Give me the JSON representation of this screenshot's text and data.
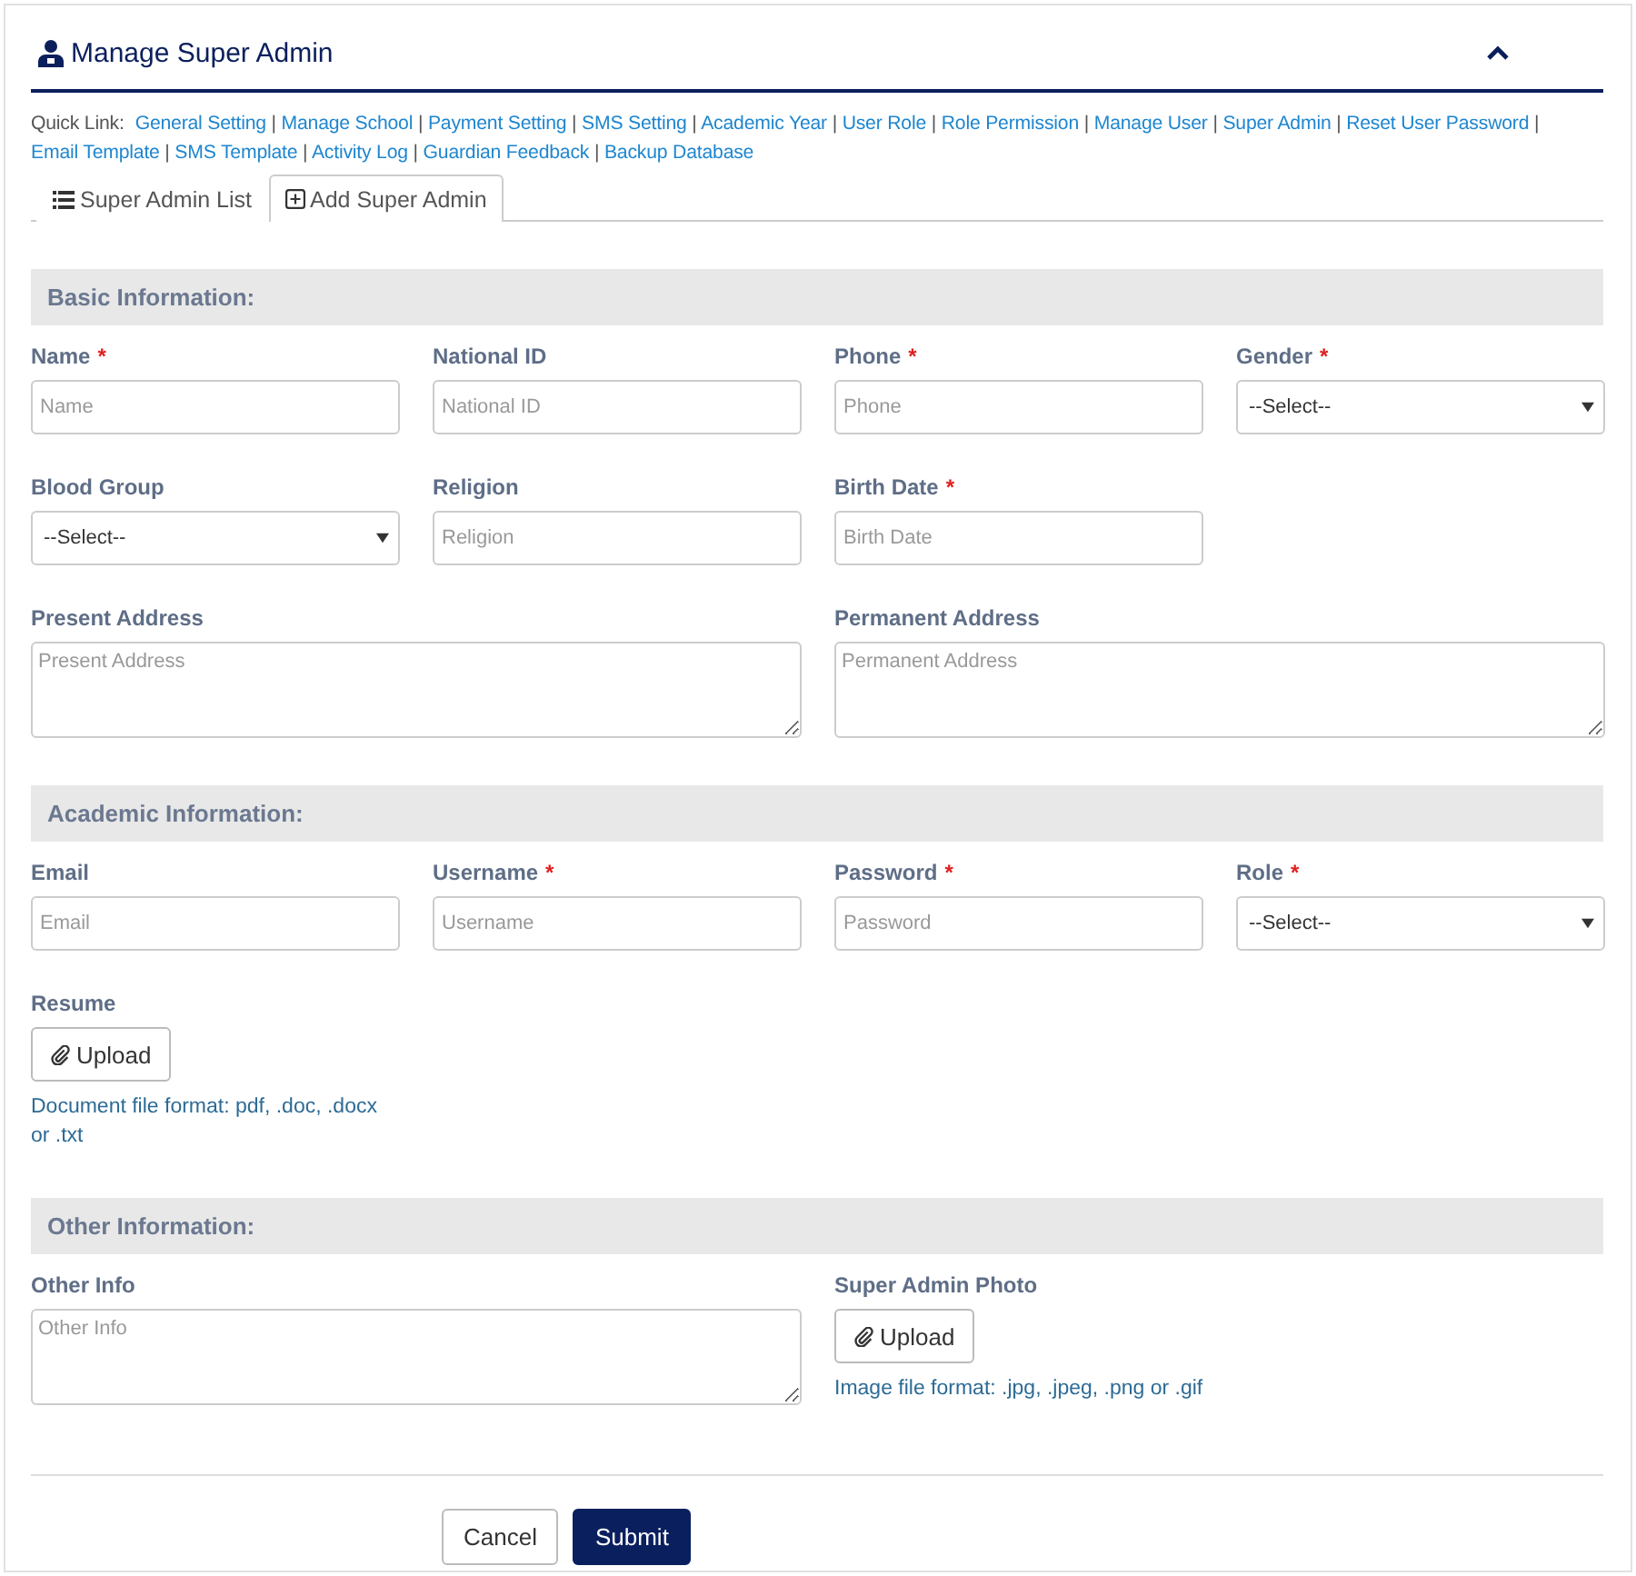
{
  "header": {
    "title": "Manage Super Admin"
  },
  "quick_links": {
    "label": "Quick Link:",
    "separator": "|",
    "links": [
      "General Setting",
      "Manage School",
      "Payment Setting",
      "SMS Setting",
      "Academic Year",
      "User Role",
      "Role Permission",
      "Manage User",
      "Super Admin",
      "Reset User Password",
      "Email Template",
      "SMS Template",
      "Activity Log",
      "Guardian Feedback",
      "Backup Database"
    ]
  },
  "tabs": [
    {
      "label": "Super Admin List",
      "kind": "list",
      "selected": false
    },
    {
      "label": "Add Super Admin",
      "kind": "add",
      "selected": true
    }
  ],
  "sections": [
    {
      "title": "Basic Information:",
      "fields": [
        {
          "kind": "text",
          "label": "Name",
          "required_mark": "*",
          "placeholder": "Name"
        },
        {
          "kind": "text",
          "label": "National ID",
          "placeholder": "National ID"
        },
        {
          "kind": "text",
          "label": "Phone",
          "required_mark": "*",
          "placeholder": "Phone"
        },
        {
          "kind": "select",
          "label": "Gender",
          "required_mark": "*",
          "value": "--Select--"
        },
        {
          "kind": "select",
          "label": "Blood Group",
          "value": "--Select--"
        },
        {
          "kind": "text",
          "label": "Religion",
          "placeholder": "Religion"
        },
        {
          "kind": "text",
          "label": "Birth Date",
          "required_mark": "*",
          "placeholder": "Birth Date"
        },
        {
          "kind": "textarea",
          "label": "Present Address",
          "placeholder": "Present Address"
        },
        {
          "kind": "textarea",
          "label": "Permanent Address",
          "placeholder": "Permanent Address"
        }
      ]
    },
    {
      "title": "Academic Information:",
      "fields": [
        {
          "kind": "text",
          "label": "Email",
          "placeholder": "Email"
        },
        {
          "kind": "text",
          "label": "Username",
          "required_mark": "*",
          "placeholder": "Username"
        },
        {
          "kind": "text",
          "label": "Password",
          "required_mark": "*",
          "placeholder": "Password"
        },
        {
          "kind": "select",
          "label": "Role",
          "required_mark": "*",
          "value": "--Select--"
        },
        {
          "kind": "upload",
          "label": "Resume",
          "button": "Upload",
          "hint": "Document file format: pdf, .doc, .docx or .txt"
        }
      ]
    },
    {
      "title": "Other Information:",
      "fields": [
        {
          "kind": "textarea",
          "label": "Other Info",
          "placeholder": "Other Info"
        },
        {
          "kind": "upload_wide",
          "label": "Super Admin Photo",
          "button": "Upload",
          "hint": "Image file format: .jpg, .jpeg, .png or .gif"
        }
      ]
    }
  ],
  "actions": {
    "cancel": "Cancel",
    "submit": "Submit"
  }
}
